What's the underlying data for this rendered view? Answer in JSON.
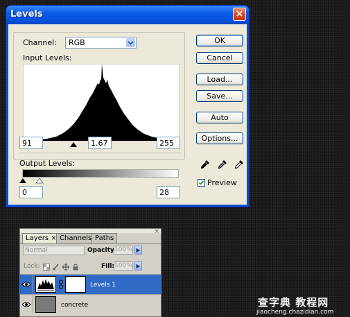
{
  "dialog": {
    "title": "Levels",
    "close_icon": "×",
    "channel_label": "Channel:",
    "channel_value": "RGB",
    "input_levels_label": "Input Levels:",
    "input_black": "91",
    "input_gamma": "1.67",
    "input_white": "255",
    "output_levels_label": "Output Levels:",
    "output_black": "0",
    "output_white": "28",
    "buttons": {
      "ok": "OK",
      "cancel": "Cancel",
      "load": "Load...",
      "save": "Save...",
      "auto": "Auto",
      "options": "Options..."
    },
    "preview_label": "Preview",
    "preview_checked": true
  },
  "layers_panel": {
    "tabs": [
      "Layers",
      "Channels",
      "Paths"
    ],
    "layers_tab_close": "×",
    "blend_mode": "Normal",
    "opacity_label": "Opacity:",
    "opacity_value": "100%",
    "lock_label": "Lock:",
    "fill_label": "Fill:",
    "fill_value": "100%",
    "layers": [
      {
        "name": "Levels 1",
        "selected": true
      },
      {
        "name": "concrete",
        "selected": false
      }
    ]
  },
  "watermark": {
    "main": "查字典 教程网",
    "url": "jiaocheng.chazidian.com"
  }
}
